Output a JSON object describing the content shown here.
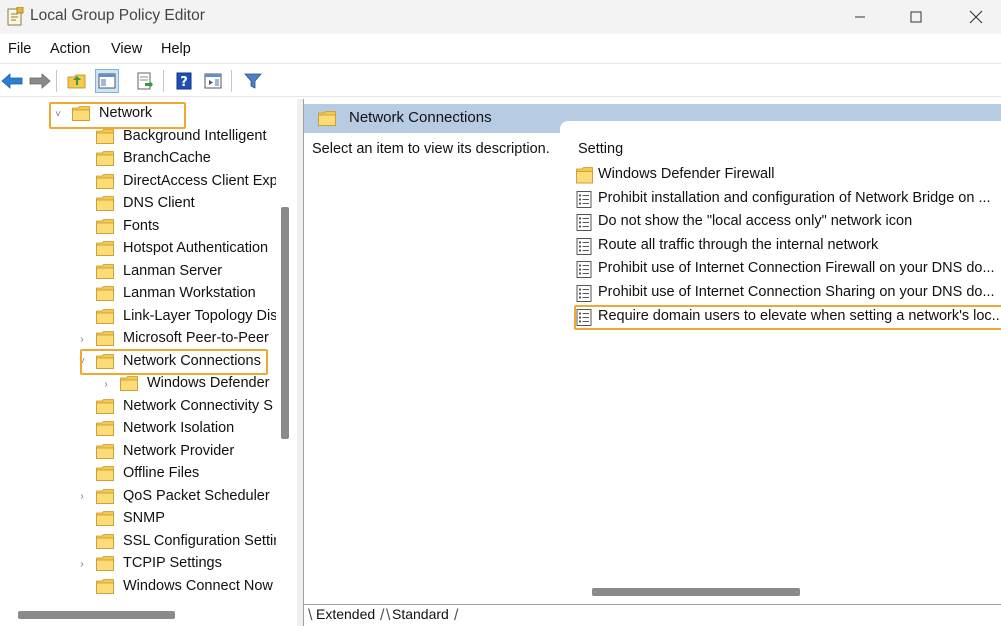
{
  "window": {
    "title": "Local Group Policy Editor"
  },
  "menu": {
    "items": [
      "File",
      "Action",
      "View",
      "Help"
    ]
  },
  "toolbar": {
    "buttons": [
      "back-icon",
      "forward-icon",
      "up-folder-icon",
      "show-hide-tree-icon",
      "export-list-icon",
      "help-icon",
      "properties-pane-icon",
      "filter-icon"
    ]
  },
  "tree": {
    "items": [
      {
        "label": "Network",
        "expander": "˅"
      },
      {
        "label": "Background Intelligent",
        "expander": ""
      },
      {
        "label": "BranchCache",
        "expander": ""
      },
      {
        "label": "DirectAccess Client Expe",
        "expander": ""
      },
      {
        "label": "DNS Client",
        "expander": ""
      },
      {
        "label": "Fonts",
        "expander": ""
      },
      {
        "label": "Hotspot Authentication",
        "expander": ""
      },
      {
        "label": "Lanman Server",
        "expander": ""
      },
      {
        "label": "Lanman Workstation",
        "expander": ""
      },
      {
        "label": "Link-Layer Topology Dis",
        "expander": ""
      },
      {
        "label": "Microsoft Peer-to-Peer",
        "expander": "›"
      },
      {
        "label": "Network Connections",
        "expander": "˅"
      },
      {
        "label": "Windows Defender",
        "expander": "›"
      },
      {
        "label": "Network Connectivity S",
        "expander": ""
      },
      {
        "label": "Network Isolation",
        "expander": ""
      },
      {
        "label": "Network Provider",
        "expander": ""
      },
      {
        "label": "Offline Files",
        "expander": ""
      },
      {
        "label": "QoS Packet Scheduler",
        "expander": "›"
      },
      {
        "label": "SNMP",
        "expander": ""
      },
      {
        "label": "SSL Configuration Settir",
        "expander": ""
      },
      {
        "label": "TCPIP Settings",
        "expander": "›"
      },
      {
        "label": "Windows Connect Now",
        "expander": ""
      }
    ]
  },
  "right": {
    "header": "Network Connections",
    "description": "Select an item to view its description.",
    "column_header": "Setting",
    "settings": [
      {
        "label": "Windows Defender Firewall",
        "icon": "folder-icon"
      },
      {
        "label": "Prohibit installation and configuration of Network Bridge on ...",
        "icon": "policy-setting-icon"
      },
      {
        "label": "Do not show the \"local access only\" network icon",
        "icon": "policy-setting-icon"
      },
      {
        "label": "Route all traffic through the internal network",
        "icon": "policy-setting-icon"
      },
      {
        "label": "Prohibit use of Internet Connection Firewall on your DNS do...",
        "icon": "policy-setting-icon"
      },
      {
        "label": "Prohibit use of Internet Connection Sharing on your DNS do...",
        "icon": "policy-setting-icon"
      },
      {
        "label": "Require domain users to elevate when setting a network's loc...",
        "icon": "policy-setting-icon"
      }
    ]
  },
  "tabs": {
    "extended": "Extended",
    "standard": "Standard"
  },
  "colors": {
    "highlight": "#f0a830",
    "header_bg": "#b7cbe3",
    "folder": "#f5c94c"
  }
}
